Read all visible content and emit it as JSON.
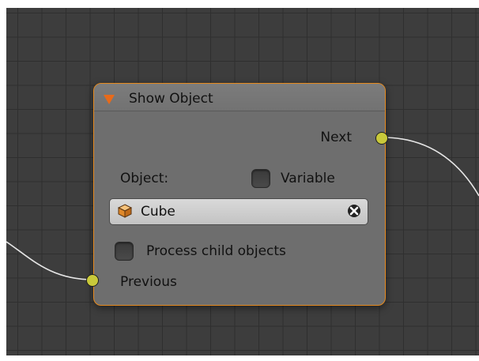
{
  "node": {
    "title": "Show Object",
    "outputs": [
      {
        "label": "Next"
      }
    ],
    "inputs": [
      {
        "label": "Previous"
      }
    ],
    "object_label": "Object:",
    "variable": {
      "label": "Variable",
      "checked": false
    },
    "object_field": {
      "value": "Cube",
      "icon": "cube-icon"
    },
    "process_children": {
      "label": "Process child objects",
      "checked": false
    }
  },
  "colors": {
    "canvas": "#3d3d3d",
    "node_border": "#e68a1e",
    "node_body": "#6e6e6e",
    "socket": "#c9c93a",
    "link": "#e6e6e6"
  }
}
